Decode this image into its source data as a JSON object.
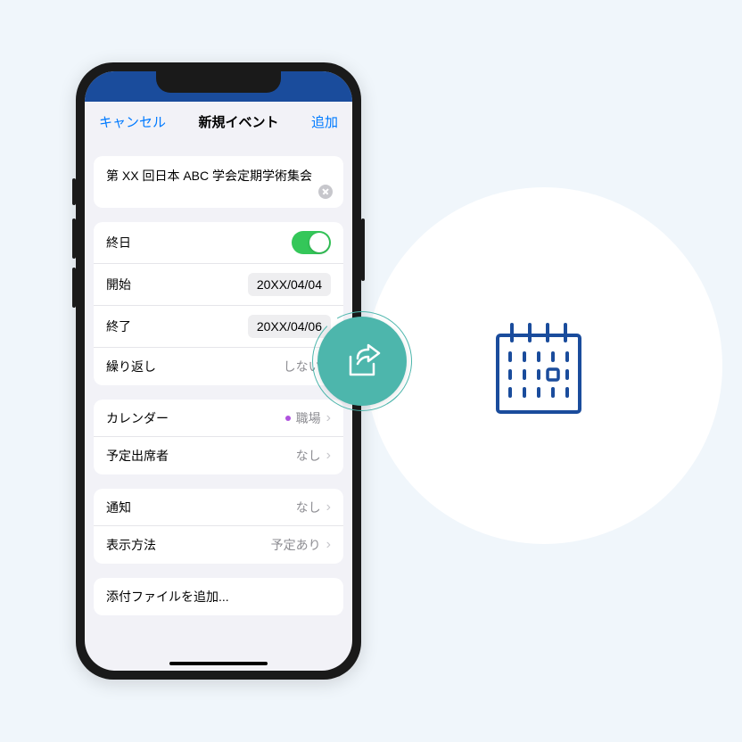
{
  "nav": {
    "cancel": "キャンセル",
    "title": "新規イベント",
    "add": "追加"
  },
  "event": {
    "title": "第 XX 回日本 ABC 学会定期学術集会"
  },
  "time": {
    "allDayLabel": "終日",
    "startLabel": "開始",
    "startValue": "20XX/04/04",
    "endLabel": "終了",
    "endValue": "20XX/04/06",
    "repeatLabel": "繰り返し",
    "repeatValue": "しない"
  },
  "cal": {
    "calendarLabel": "カレンダー",
    "calendarValue": "職場",
    "inviteesLabel": "予定出席者",
    "inviteesValue": "なし"
  },
  "alert": {
    "alertLabel": "通知",
    "alertValue": "なし",
    "showAsLabel": "表示方法",
    "showAsValue": "予定あり"
  },
  "attach": {
    "label": "添付ファイルを追加..."
  }
}
